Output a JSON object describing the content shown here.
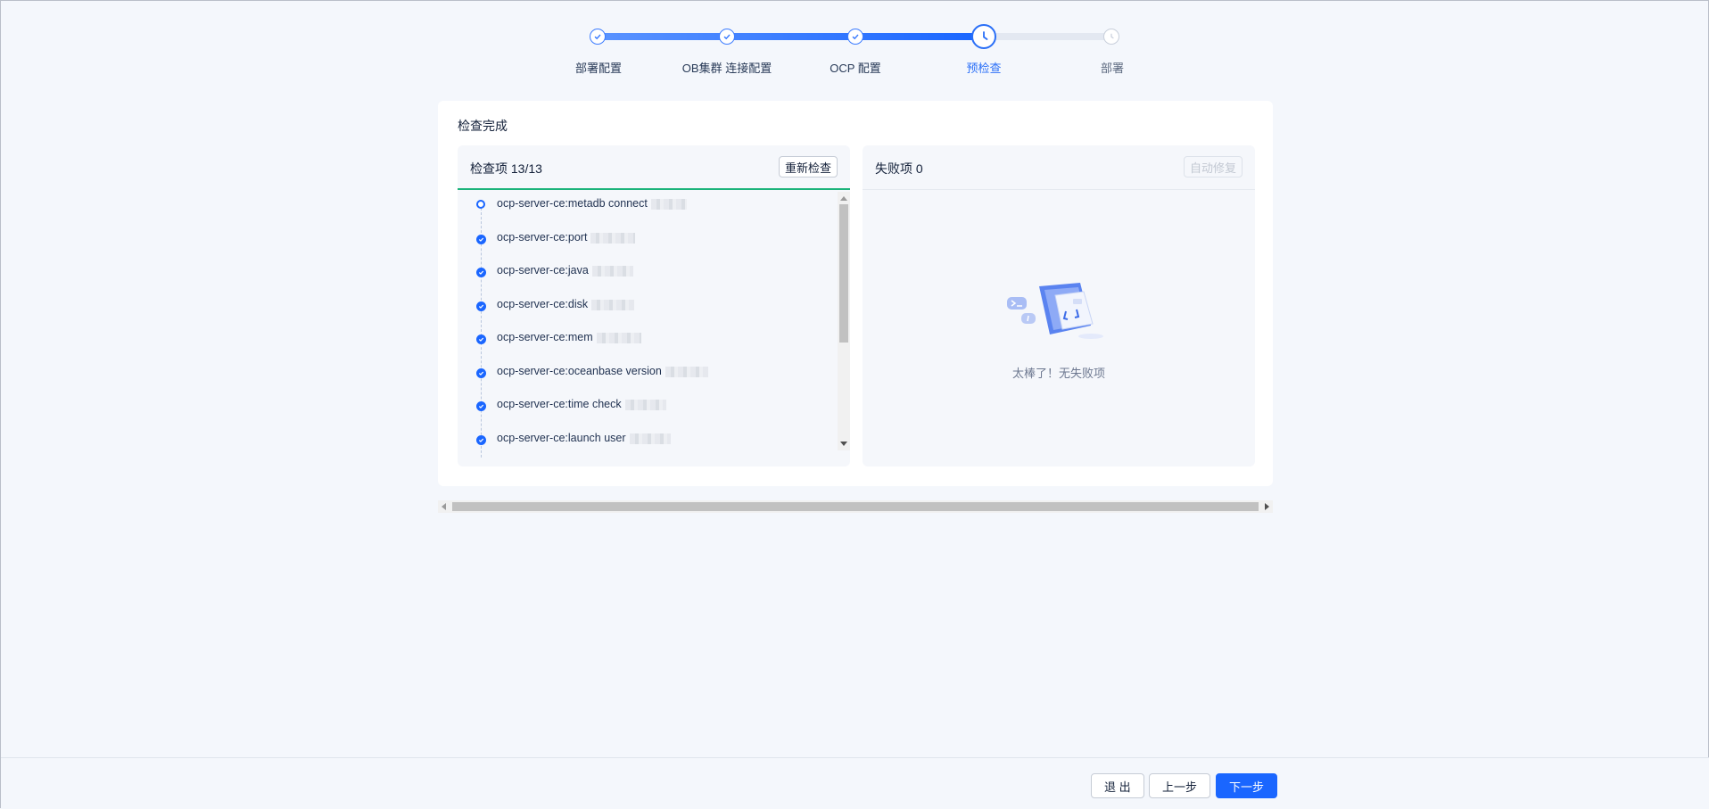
{
  "stepper": {
    "steps": [
      {
        "label": "部署配置",
        "state": "done"
      },
      {
        "label": "OB集群 连接配置",
        "state": "done"
      },
      {
        "label": "OCP 配置",
        "state": "done"
      },
      {
        "label": "预检查",
        "state": "current"
      },
      {
        "label": "部署",
        "state": "pending"
      }
    ],
    "progress_fraction": 0.75
  },
  "card": {
    "title": "检查完成"
  },
  "check_panel": {
    "title": "检查项 13/13",
    "recheck_button": "重新检查",
    "items": [
      {
        "text": "ocp-server-ce:metadb connect",
        "state": "running"
      },
      {
        "text": "ocp-server-ce:port",
        "state": "done"
      },
      {
        "text": "ocp-server-ce:java",
        "state": "done"
      },
      {
        "text": "ocp-server-ce:disk",
        "state": "done"
      },
      {
        "text": "ocp-server-ce:mem",
        "state": "done"
      },
      {
        "text": "ocp-server-ce:oceanbase version",
        "state": "done"
      },
      {
        "text": "ocp-server-ce:time check",
        "state": "done"
      },
      {
        "text": "ocp-server-ce:launch user",
        "state": "done"
      }
    ]
  },
  "fail_panel": {
    "title": "失败项 0",
    "autofix_button": "自动修复",
    "empty_text": "太棒了！无失败项"
  },
  "footer": {
    "exit": "退 出",
    "prev": "上一步",
    "next": "下一步"
  },
  "colors": {
    "primary": "#1a66ff",
    "success_line": "#1bb37a"
  }
}
